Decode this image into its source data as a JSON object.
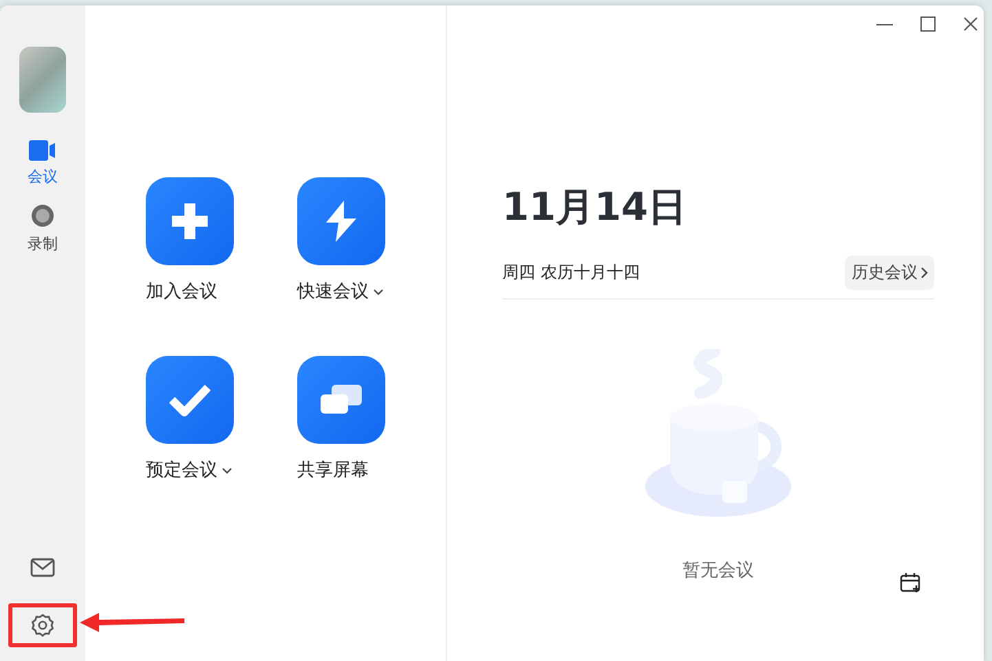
{
  "sidebar": {
    "nav": [
      {
        "kind": "meeting",
        "label": "会议",
        "selected": true
      },
      {
        "kind": "record",
        "label": "录制",
        "selected": false
      }
    ],
    "bottom": [
      {
        "kind": "mail",
        "highlighted": false
      },
      {
        "kind": "settings",
        "highlighted": true
      }
    ]
  },
  "actions": [
    {
      "kind": "join",
      "label": "加入会议",
      "dropdown": false
    },
    {
      "kind": "quick",
      "label": "快速会议",
      "dropdown": true
    },
    {
      "kind": "schedule",
      "label": "预定会议",
      "dropdown": true
    },
    {
      "kind": "share",
      "label": "共享屏幕",
      "dropdown": false
    }
  ],
  "date": {
    "day": "11月14日",
    "weekday": "周四 农历十月十四",
    "history_button": "历史会议"
  },
  "empty_text": "暂无会议"
}
